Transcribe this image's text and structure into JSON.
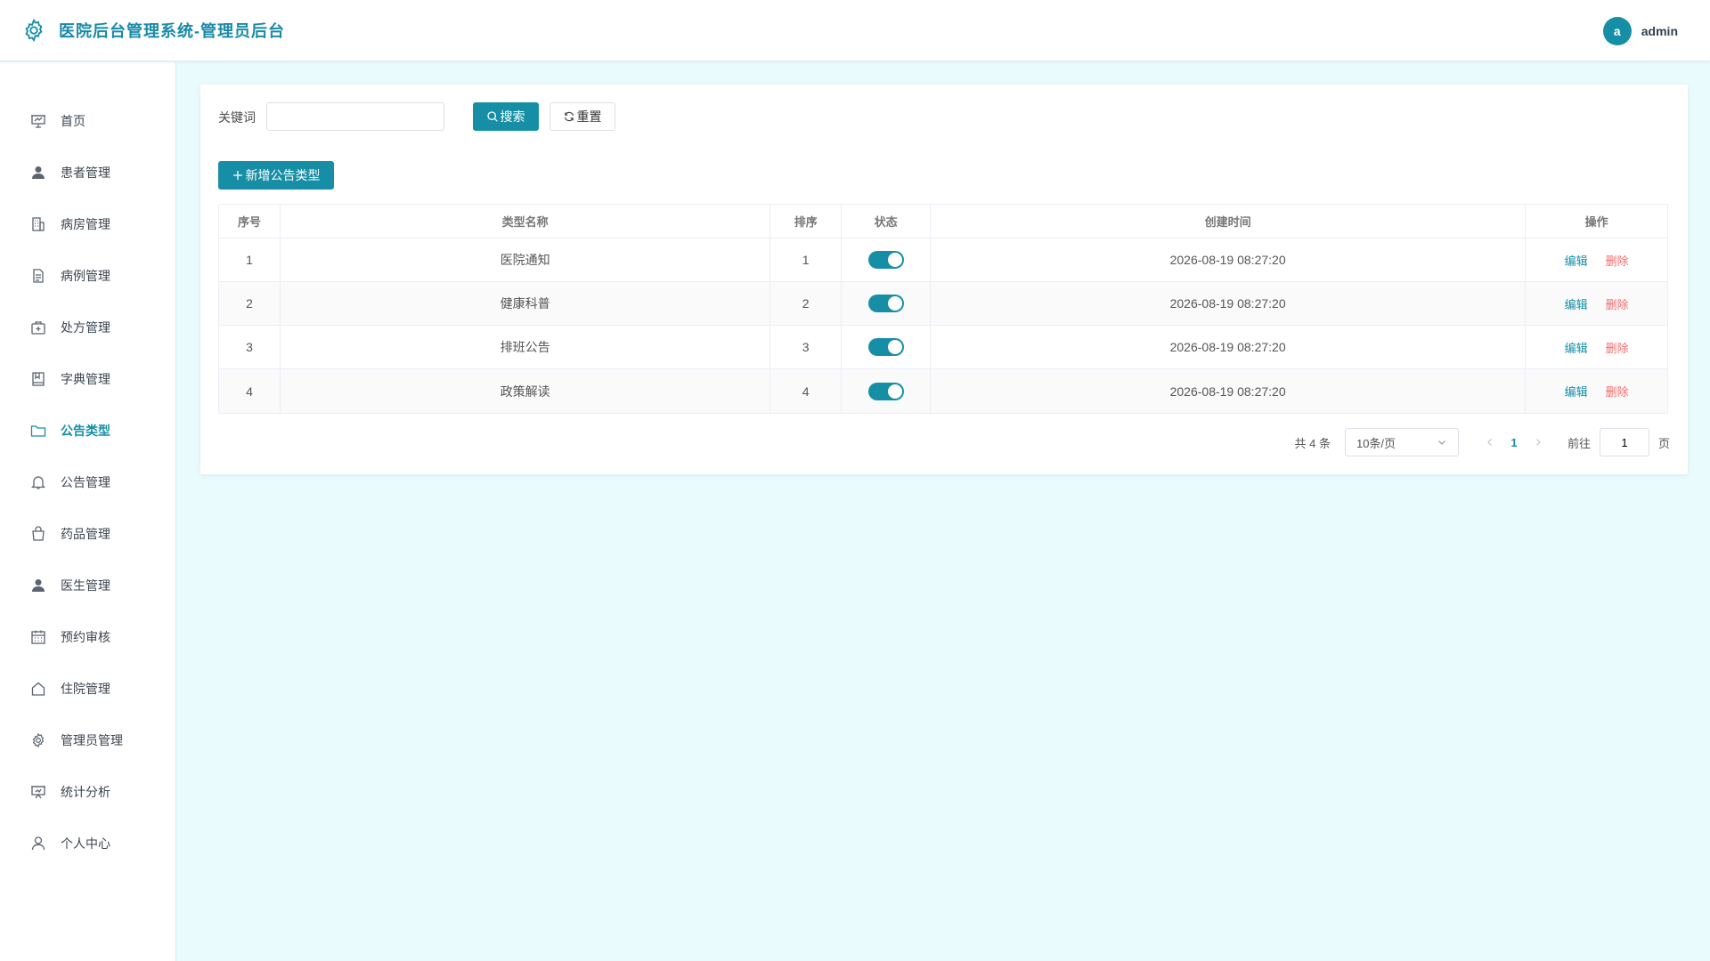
{
  "header": {
    "title": "医院后台管理系统-管理员后台",
    "avatar_letter": "a",
    "username": "admin"
  },
  "sidebar": {
    "items": [
      {
        "label": "首页",
        "icon": "presentation-icon"
      },
      {
        "label": "患者管理",
        "icon": "user-filled-icon"
      },
      {
        "label": "病房管理",
        "icon": "building-icon"
      },
      {
        "label": "病例管理",
        "icon": "document-icon"
      },
      {
        "label": "处方管理",
        "icon": "first-aid-kit-icon"
      },
      {
        "label": "字典管理",
        "icon": "notebook-icon"
      },
      {
        "label": "公告类型",
        "icon": "folder-icon",
        "active": true
      },
      {
        "label": "公告管理",
        "icon": "bell-icon"
      },
      {
        "label": "药品管理",
        "icon": "shopping-bag-icon"
      },
      {
        "label": "医生管理",
        "icon": "user-filled-icon"
      },
      {
        "label": "预约审核",
        "icon": "calendar-icon"
      },
      {
        "label": "住院管理",
        "icon": "house-icon"
      },
      {
        "label": "管理员管理",
        "icon": "gear-icon"
      },
      {
        "label": "统计分析",
        "icon": "data-board-icon"
      },
      {
        "label": "个人中心",
        "icon": "user-outline-icon"
      }
    ]
  },
  "search": {
    "keyword_label": "关键词",
    "keyword_value": "",
    "keyword_placeholder": "",
    "search_label": "搜索",
    "reset_label": "重置",
    "add_label": "新增公告类型"
  },
  "table": {
    "headers": [
      "序号",
      "类型名称",
      "排序",
      "状态",
      "创建时间",
      "操作"
    ],
    "rows": [
      {
        "index": "1",
        "name": "医院通知",
        "sort": "1",
        "enabled": true,
        "created": "2026-08-19 08:27:20"
      },
      {
        "index": "2",
        "name": "健康科普",
        "sort": "2",
        "enabled": true,
        "created": "2026-08-19 08:27:20"
      },
      {
        "index": "3",
        "name": "排班公告",
        "sort": "3",
        "enabled": true,
        "created": "2026-08-19 08:27:20"
      },
      {
        "index": "4",
        "name": "政策解读",
        "sort": "4",
        "enabled": true,
        "created": "2026-08-19 08:27:20"
      }
    ],
    "edit_label": "编辑",
    "delete_label": "删除"
  },
  "pagination": {
    "total": "共 4 条",
    "page_size": "10条/页",
    "current_page": "1",
    "goto_label": "前往",
    "goto_value": "1",
    "page_unit": "页"
  },
  "colors": {
    "accent": "#168fa6",
    "danger": "#f56c6c",
    "background": "#e9fbfd"
  }
}
